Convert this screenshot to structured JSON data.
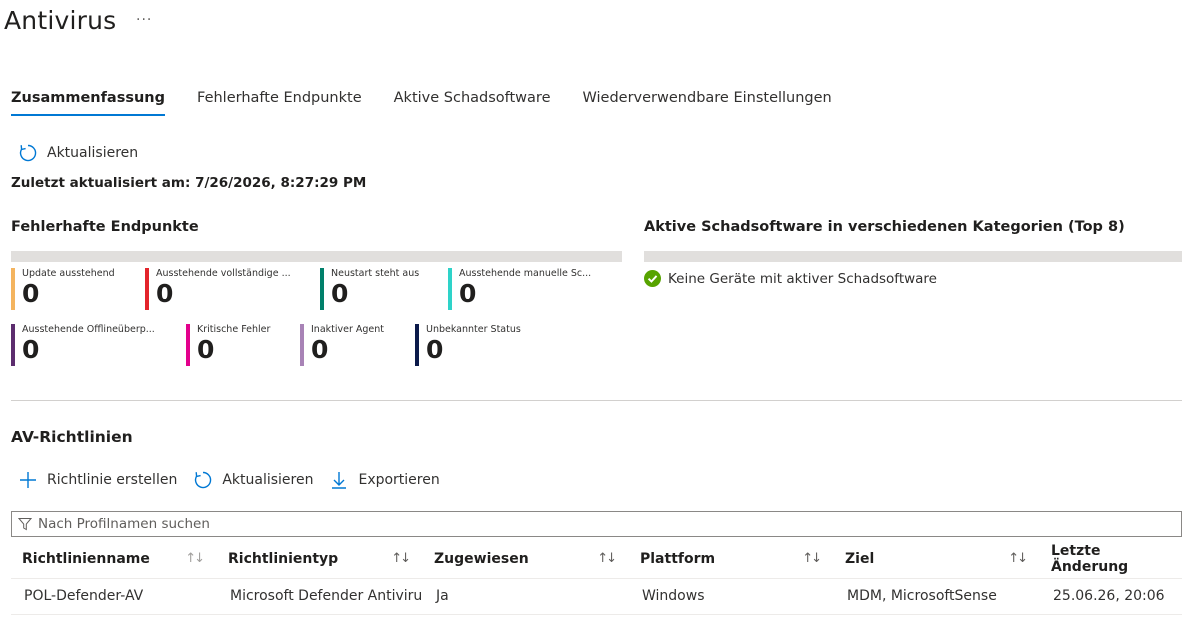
{
  "page": {
    "title": "Antivirus",
    "more": "···"
  },
  "tabs": [
    {
      "label": "Zusammenfassung",
      "active": true
    },
    {
      "label": "Fehlerhafte Endpunkte"
    },
    {
      "label": "Aktive Schadsoftware"
    },
    {
      "label": "Wiederverwendbare Einstellungen"
    }
  ],
  "summary": {
    "refresh_label": "Aktualisieren",
    "last_updated": "Zuletzt aktualisiert am: 7/26/2026, 8:27:29 PM"
  },
  "endpoints": {
    "title": "Fehlerhafte Endpunkte",
    "tiles": [
      {
        "label": "Update ausstehend",
        "value": "0",
        "color": "#f4b45f"
      },
      {
        "label": "Ausstehende vollständige ...",
        "value": "0",
        "color": "#e3242b"
      },
      {
        "label": "Neustart steht aus",
        "value": "0",
        "color": "#00806b"
      },
      {
        "label": "Ausstehende manuelle Sc...",
        "value": "0",
        "color": "#2ed3c9"
      },
      {
        "label": "Ausstehende Offlineüberp...",
        "value": "0",
        "color": "#5c2d6e"
      },
      {
        "label": "Kritische Fehler",
        "value": "0",
        "color": "#e3008c"
      },
      {
        "label": "Inaktiver Agent",
        "value": "0",
        "color": "#a883b6"
      },
      {
        "label": "Unbekannter Status",
        "value": "0",
        "color": "#0b1a4a"
      }
    ]
  },
  "malware": {
    "title": "Aktive Schadsoftware in verschiedenen Kategorien (Top 8)",
    "status": "Keine Geräte mit aktiver Schadsoftware",
    "status_color": "#57a300"
  },
  "policies": {
    "title": "AV-Richtlinien",
    "toolbar": {
      "create": "Richtlinie erstellen",
      "refresh": "Aktualisieren",
      "export": "Exportieren"
    },
    "search_placeholder": "Nach Profilnamen suchen",
    "columns": [
      "Richtlinienname",
      "Richtlinientyp",
      "Zugewiesen",
      "Plattform",
      "Ziel",
      "Letzte Änderung"
    ],
    "rows": [
      [
        "POL-Defender-AV",
        "Microsoft Defender Antivirus",
        "Ja",
        "Windows",
        "MDM, MicrosoftSense",
        "25.06.26, 20:06"
      ]
    ]
  },
  "colors": {
    "accent": "#0078d4"
  }
}
